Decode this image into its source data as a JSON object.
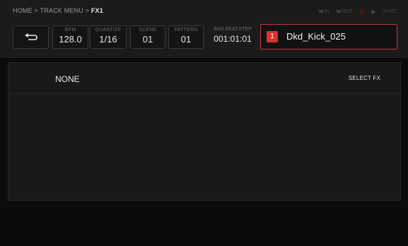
{
  "breadcrumb": {
    "path": "HOME > TRACK MENU > ",
    "current": "FX1"
  },
  "status_indicators": {
    "in_label": "IN",
    "out_label": "OUT",
    "sync_label": "SYNC"
  },
  "back_button": {
    "icon": "return-arrow-icon"
  },
  "params": {
    "bpm": {
      "label": "BPM",
      "value": "128.0"
    },
    "quantize": {
      "label": "QUANTIZE",
      "value": "1/16"
    },
    "scene": {
      "label": "SCENE",
      "value": "01"
    },
    "pattern": {
      "label": "PATTERN",
      "value": "01"
    },
    "bar_beat_step": {
      "label": "BAR.BEAT.STEP",
      "value": "001:01:01"
    }
  },
  "track": {
    "number": "1",
    "name": "Dkd_Kick_025",
    "accent": "#d8322f"
  },
  "fx": {
    "current": "NONE",
    "select_label": "SELECT FX"
  }
}
